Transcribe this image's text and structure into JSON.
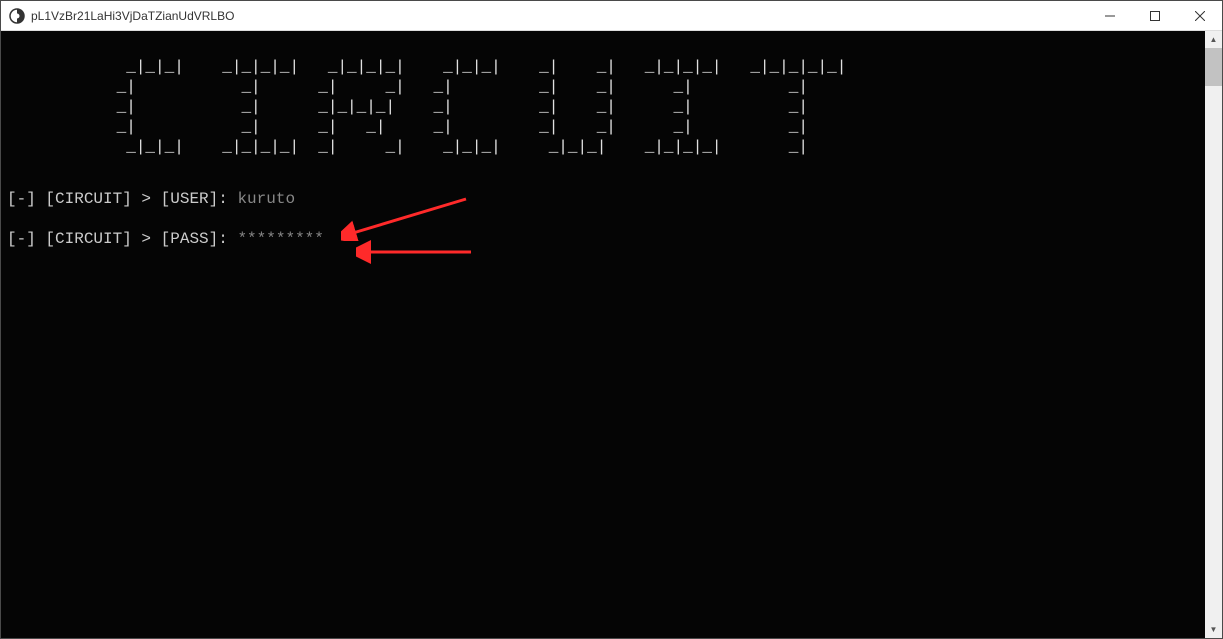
{
  "window": {
    "title": "pL1VzBr21LaHi3VjDaTZianUdVRLBO"
  },
  "ascii_art": "  _|_|_|\\  _|_|_|_| _|_|_|_| _|_|_|\\  _|    _| _|_|_|_| _|_|_|_|_|\n _|         _|     _|     _| _|         _|    _|    _|        _|\n _|         _|     _|_|_|_|  _|         _|    _|    _|        _|\n _|         _|     _|  _|    _|         _|    _|    _|        _|\n  _|_|_|/ _|_|_|_| _|    _|   _|_|_|/   _|_|_|   _|_|_|_|     _|",
  "prompts": {
    "user": {
      "prefix": "[-] ",
      "app": "[CIRCUIT]",
      "sep": " > ",
      "field": "[USER]",
      "colon": ": ",
      "value": "kuruto"
    },
    "pass": {
      "prefix": "[-] ",
      "app": "[CIRCUIT]",
      "sep": " > ",
      "field": "[PASS]",
      "colon": ": ",
      "value": "*********"
    }
  },
  "ascii_lines": [
    "            _|_|_|    _|_|_|_|   _|_|_|_|    _|_|_|    _|    _|   _|_|_|_|   _|_|_|_|_|",
    "           _|           _|      _|     _|   _|         _|    _|      _|          _|",
    "           _|           _|      _|_|_|_|    _|         _|    _|      _|          _|",
    "           _|           _|      _|   _|     _|         _|    _|      _|          _|",
    "            _|_|_|    _|_|_|_|  _|     _|    _|_|_|     _|_|_|    _|_|_|_|       _|"
  ]
}
